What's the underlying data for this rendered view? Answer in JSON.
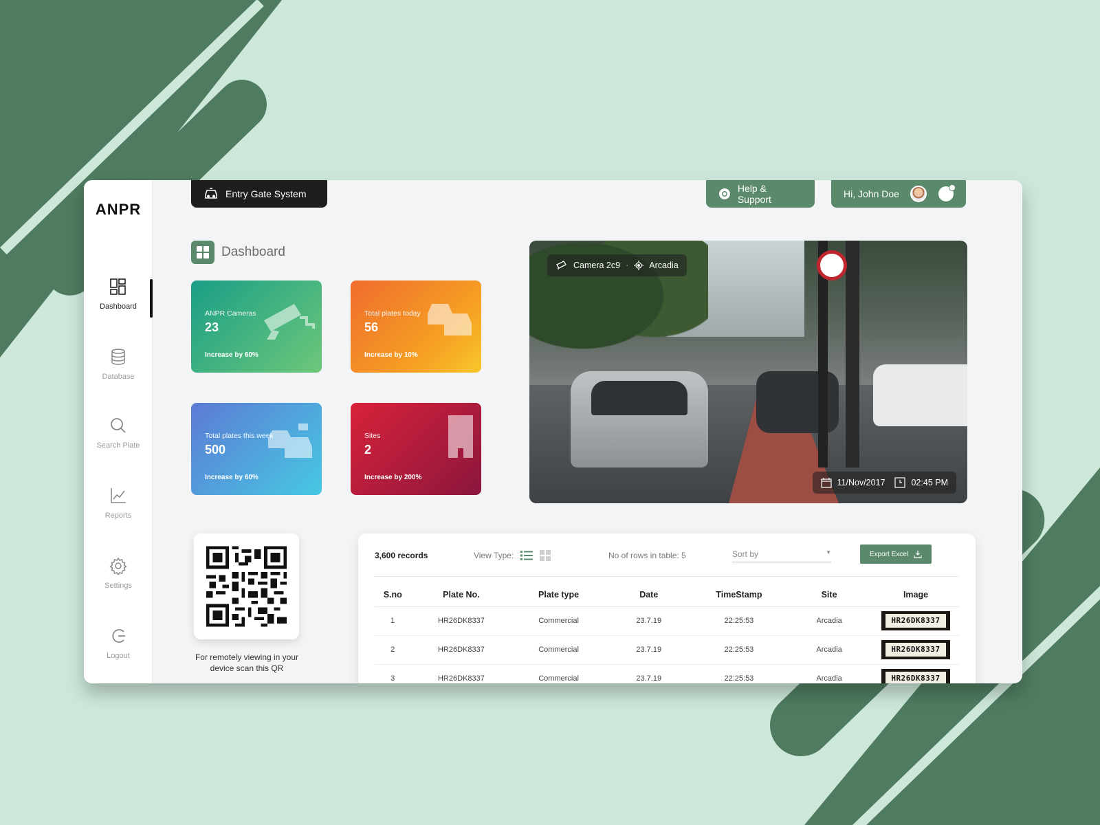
{
  "app": {
    "logo": "ANPR"
  },
  "sidebar": {
    "items": [
      {
        "label": "Dashboard",
        "icon": "dashboard-icon",
        "active": true
      },
      {
        "label": "Database",
        "icon": "database-icon"
      },
      {
        "label": "Search Plate",
        "icon": "search-icon"
      },
      {
        "label": "Reports",
        "icon": "chart-icon"
      },
      {
        "label": "Settings",
        "icon": "gear-icon"
      },
      {
        "label": "Logout",
        "icon": "logout-icon"
      }
    ]
  },
  "header": {
    "system_label": "Entry Gate System",
    "help_label": "Help & Support",
    "greeting": "Hi, John Doe"
  },
  "dashboard": {
    "title": "Dashboard"
  },
  "cards": [
    {
      "title": "ANPR Cameras",
      "value": "23",
      "sub": "Increase by 60%",
      "icon": "cctv-icon"
    },
    {
      "title": "Total plates today",
      "value": "56",
      "sub": "Increase by 10%",
      "icon": "cars-icon"
    },
    {
      "title": "Total plates this week",
      "value": "500",
      "sub": "Increase by 60%",
      "icon": "cars-icon"
    },
    {
      "title": "Sites",
      "value": "2",
      "sub": "Increase by 200%",
      "icon": "building-icon"
    }
  ],
  "camera": {
    "name": "Camera 2c9",
    "location": "Arcadia",
    "date": "11/Nov/2017",
    "time": "02:45 PM"
  },
  "qr": {
    "caption": "For remotely viewing in your device scan this QR"
  },
  "table": {
    "records": "3,600 records",
    "view_type_label": "View Type:",
    "rows_label": "No of rows in table: 5",
    "sort_placeholder": "Sort by",
    "export_label": "Export Excel",
    "columns": [
      "S.no",
      "Plate No.",
      "Plate type",
      "Date",
      "TimeStamp",
      "Site",
      "Image"
    ],
    "rows": [
      {
        "sno": "1",
        "plate": "HR26DK8337",
        "type": "Commercial",
        "date": "23.7.19",
        "time": "22:25:53",
        "site": "Arcadia",
        "image_text": "HR26DK8337"
      },
      {
        "sno": "2",
        "plate": "HR26DK8337",
        "type": "Commercial",
        "date": "23.7.19",
        "time": "22:25:53",
        "site": "Arcadia",
        "image_text": "HR26DK8337"
      },
      {
        "sno": "3",
        "plate": "HR26DK8337",
        "type": "Commercial",
        "date": "23.7.19",
        "time": "22:25:53",
        "site": "Arcadia",
        "image_text": "HR26DK8337"
      }
    ]
  },
  "colors": {
    "brand_green": "#5a8a6b",
    "background": "#cde8da",
    "card_teal": "#1a9e86",
    "card_orange": "#ef6c2d",
    "card_blue": "#5c7bd4",
    "card_red": "#d8223a"
  }
}
